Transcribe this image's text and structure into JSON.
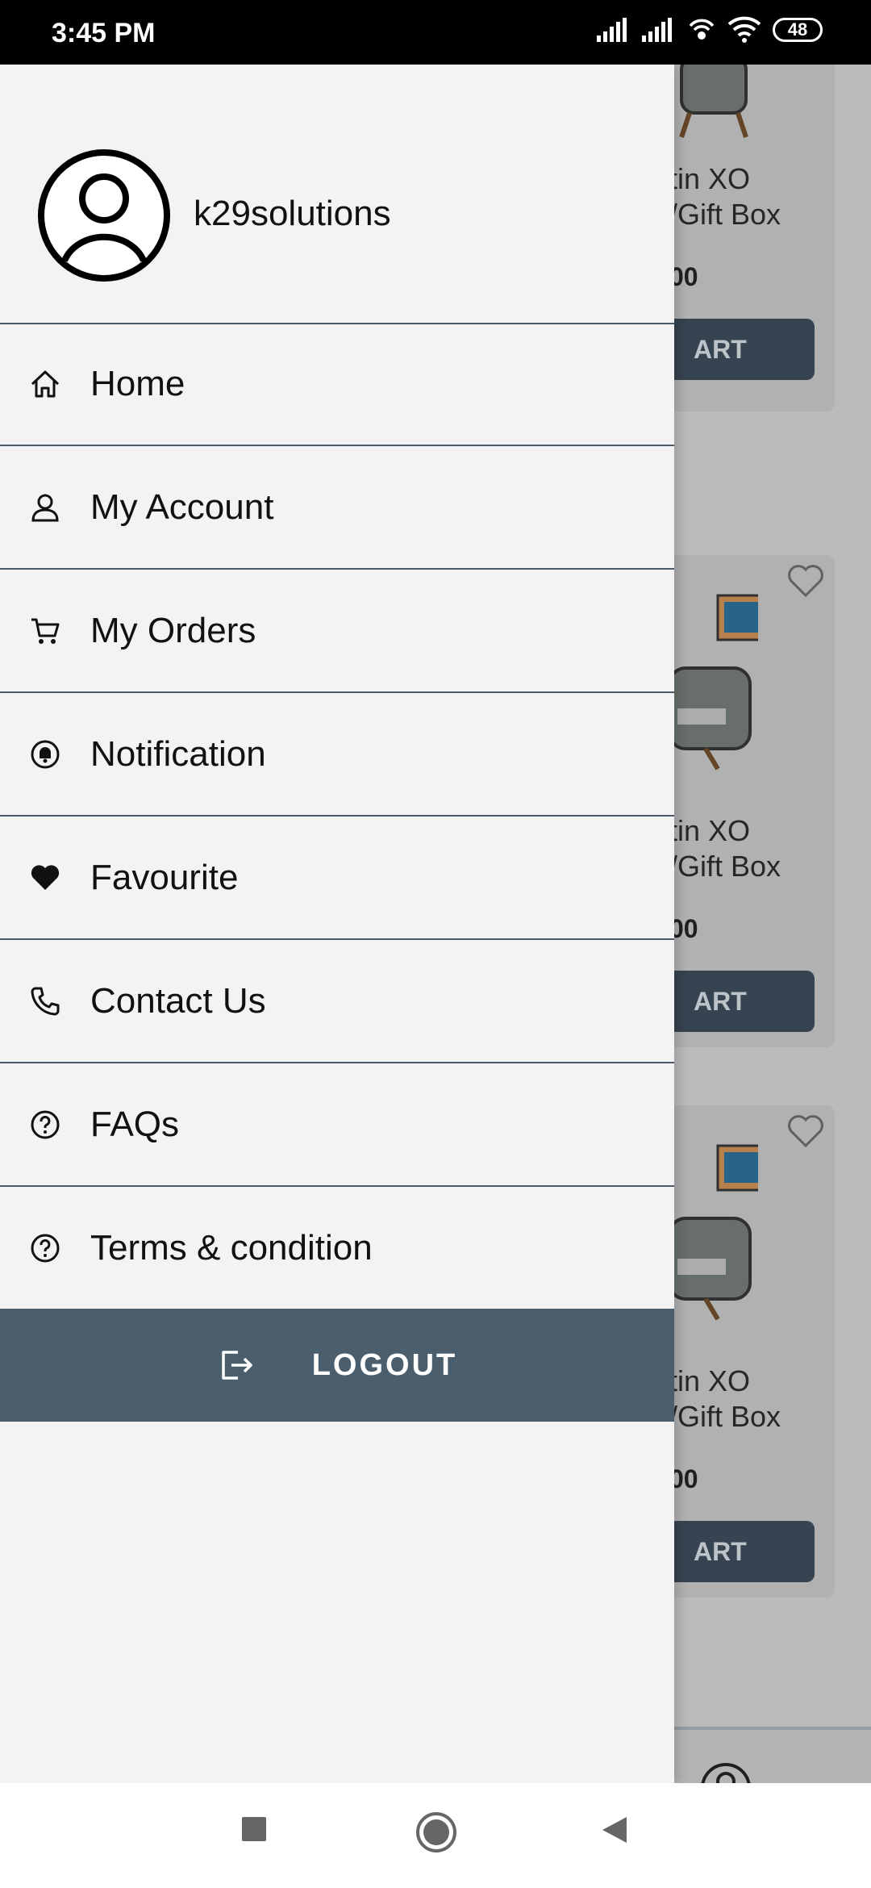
{
  "status_bar": {
    "time": "3:45 PM",
    "battery": "48"
  },
  "background": {
    "cards": [
      {
        "title_line1": "tin XO",
        "title_line2": "/Gift Box",
        "price": "00",
        "button": "ART"
      },
      {
        "title_line1": "tin XO",
        "title_line2": "/Gift Box",
        "price": "00",
        "button": "ART"
      },
      {
        "title_line1": "tin XO",
        "title_line2": "/Gift Box",
        "price": "00",
        "button": "ART"
      }
    ]
  },
  "drawer": {
    "username": "k29solutions",
    "menu": [
      {
        "label": "Home",
        "icon": "home-icon"
      },
      {
        "label": "My Account",
        "icon": "user-icon"
      },
      {
        "label": "My Orders",
        "icon": "cart-icon"
      },
      {
        "label": "Notification",
        "icon": "bell-icon"
      },
      {
        "label": "Favourite",
        "icon": "heart-icon"
      },
      {
        "label": "Contact Us",
        "icon": "phone-icon"
      },
      {
        "label": "FAQs",
        "icon": "question-icon"
      },
      {
        "label": "Terms & condition",
        "icon": "question-icon"
      }
    ],
    "logout_label": "LOGOUT"
  },
  "colors": {
    "drawer_bg": "#f3f3f3",
    "accent": "#4b5e6d",
    "divider": "#4a5a69"
  }
}
